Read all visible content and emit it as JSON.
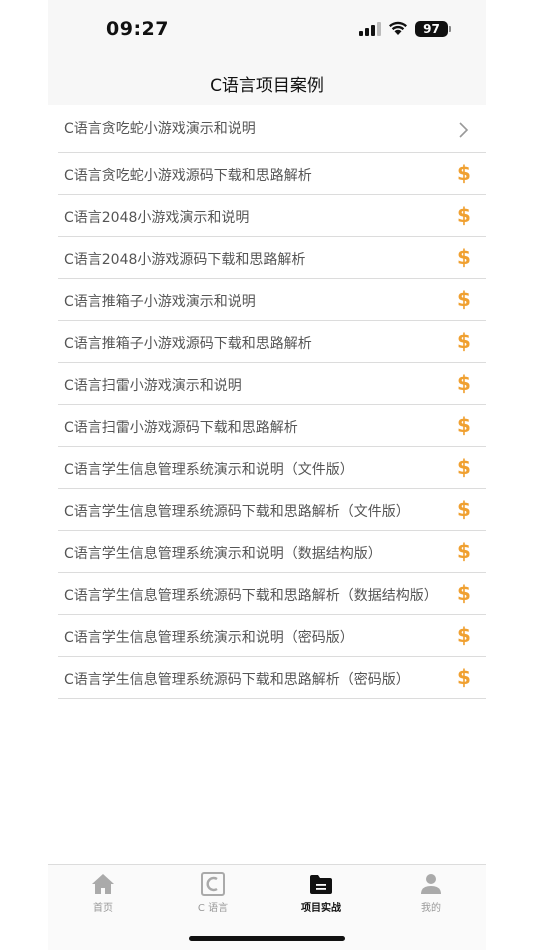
{
  "status_bar": {
    "time": "09:27",
    "battery": "97"
  },
  "header": {
    "title": "C语言项目案例"
  },
  "items": [
    {
      "label": "C语言贪吃蛇小游戏演示和说明",
      "badge": "chevron"
    },
    {
      "label": "C语言贪吃蛇小游戏源码下载和思路解析",
      "badge": "$"
    },
    {
      "label": "C语言2048小游戏演示和说明",
      "badge": "$"
    },
    {
      "label": "C语言2048小游戏源码下载和思路解析",
      "badge": "$"
    },
    {
      "label": "C语言推箱子小游戏演示和说明",
      "badge": "$"
    },
    {
      "label": "C语言推箱子小游戏源码下载和思路解析",
      "badge": "$"
    },
    {
      "label": "C语言扫雷小游戏演示和说明",
      "badge": "$"
    },
    {
      "label": "C语言扫雷小游戏源码下载和思路解析",
      "badge": "$"
    },
    {
      "label": "C语言学生信息管理系统演示和说明（文件版）",
      "badge": "$"
    },
    {
      "label": "C语言学生信息管理系统源码下载和思路解析（文件版）",
      "badge": "$"
    },
    {
      "label": "C语言学生信息管理系统演示和说明（数据结构版）",
      "badge": "$"
    },
    {
      "label": "C语言学生信息管理系统源码下载和思路解析（数据结构版）",
      "badge": "$"
    },
    {
      "label": "C语言学生信息管理系统演示和说明（密码版）",
      "badge": "$"
    },
    {
      "label": "C语言学生信息管理系统源码下载和思路解析（密码版）",
      "badge": "$"
    }
  ],
  "tabs": [
    {
      "label": "首页",
      "icon": "home-icon",
      "active": false
    },
    {
      "label": "C 语言",
      "icon": "c-language-icon",
      "active": false
    },
    {
      "label": "项目实战",
      "icon": "folder-icon",
      "active": true
    },
    {
      "label": "我的",
      "icon": "person-icon",
      "active": false
    }
  ],
  "colors": {
    "dollar": "#f0a030",
    "active_tab": "#111111",
    "inactive_tab": "#999999"
  }
}
